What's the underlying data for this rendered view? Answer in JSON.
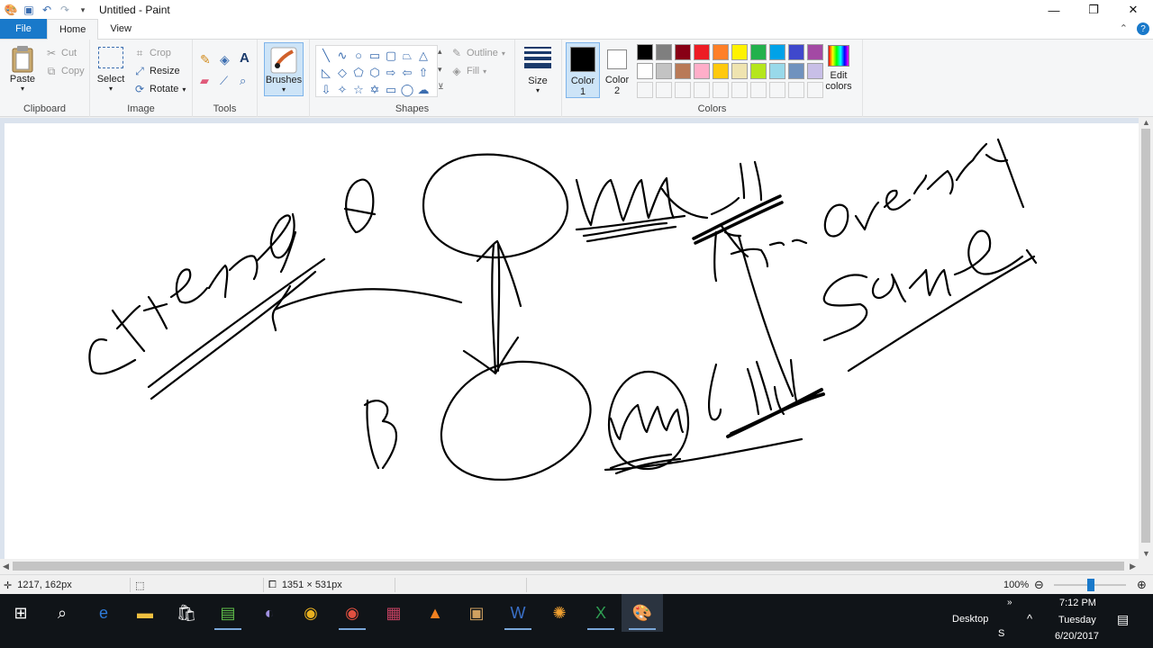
{
  "window": {
    "title": "Untitled - Paint"
  },
  "tabs": {
    "file": "File",
    "home": "Home",
    "view": "View"
  },
  "ribbon": {
    "clipboard": {
      "label": "Clipboard",
      "paste": "Paste",
      "cut": "Cut",
      "copy": "Copy"
    },
    "image": {
      "label": "Image",
      "select": "Select",
      "crop": "Crop",
      "resize": "Resize",
      "rotate": "Rotate"
    },
    "tools": {
      "label": "Tools"
    },
    "brushes": {
      "label": "Brushes"
    },
    "shapes": {
      "label": "Shapes",
      "outline": "Outline",
      "fill": "Fill"
    },
    "size": {
      "label": "Size"
    },
    "colors": {
      "label": "Colors",
      "color1": "Color\n1",
      "color1_line1": "Color",
      "color1_line2": "1",
      "color2_line1": "Color",
      "color2_line2": "2",
      "edit_line1": "Edit",
      "edit_line2": "colors",
      "color1_value": "#000000",
      "color2_value": "#ffffff",
      "palette_row1": [
        "#000000",
        "#7f7f7f",
        "#880015",
        "#ed1c24",
        "#ff7f27",
        "#fff200",
        "#22b14c",
        "#00a2e8",
        "#3f48cc",
        "#a349a4"
      ],
      "palette_row2": [
        "#ffffff",
        "#c3c3c3",
        "#b97a57",
        "#ffaec9",
        "#ffc90e",
        "#efe4b0",
        "#b5e61d",
        "#99d9ea",
        "#7092be",
        "#c8bfe7"
      ],
      "palette_row3": [
        "#f5f6f7",
        "#f5f6f7",
        "#f5f6f7",
        "#f5f6f7",
        "#f5f6f7",
        "#f5f6f7",
        "#f5f6f7",
        "#f5f6f7",
        "#f5f6f7",
        "#f5f6f7"
      ]
    }
  },
  "status": {
    "cursor": "1217, 162px",
    "canvas_size": "1351 × 531px",
    "zoom": "100%"
  },
  "taskbar": {
    "desktop": "Desktop",
    "time": "7:12 PM",
    "day": "Tuesday",
    "date": "6/20/2017",
    "lang": "S"
  }
}
